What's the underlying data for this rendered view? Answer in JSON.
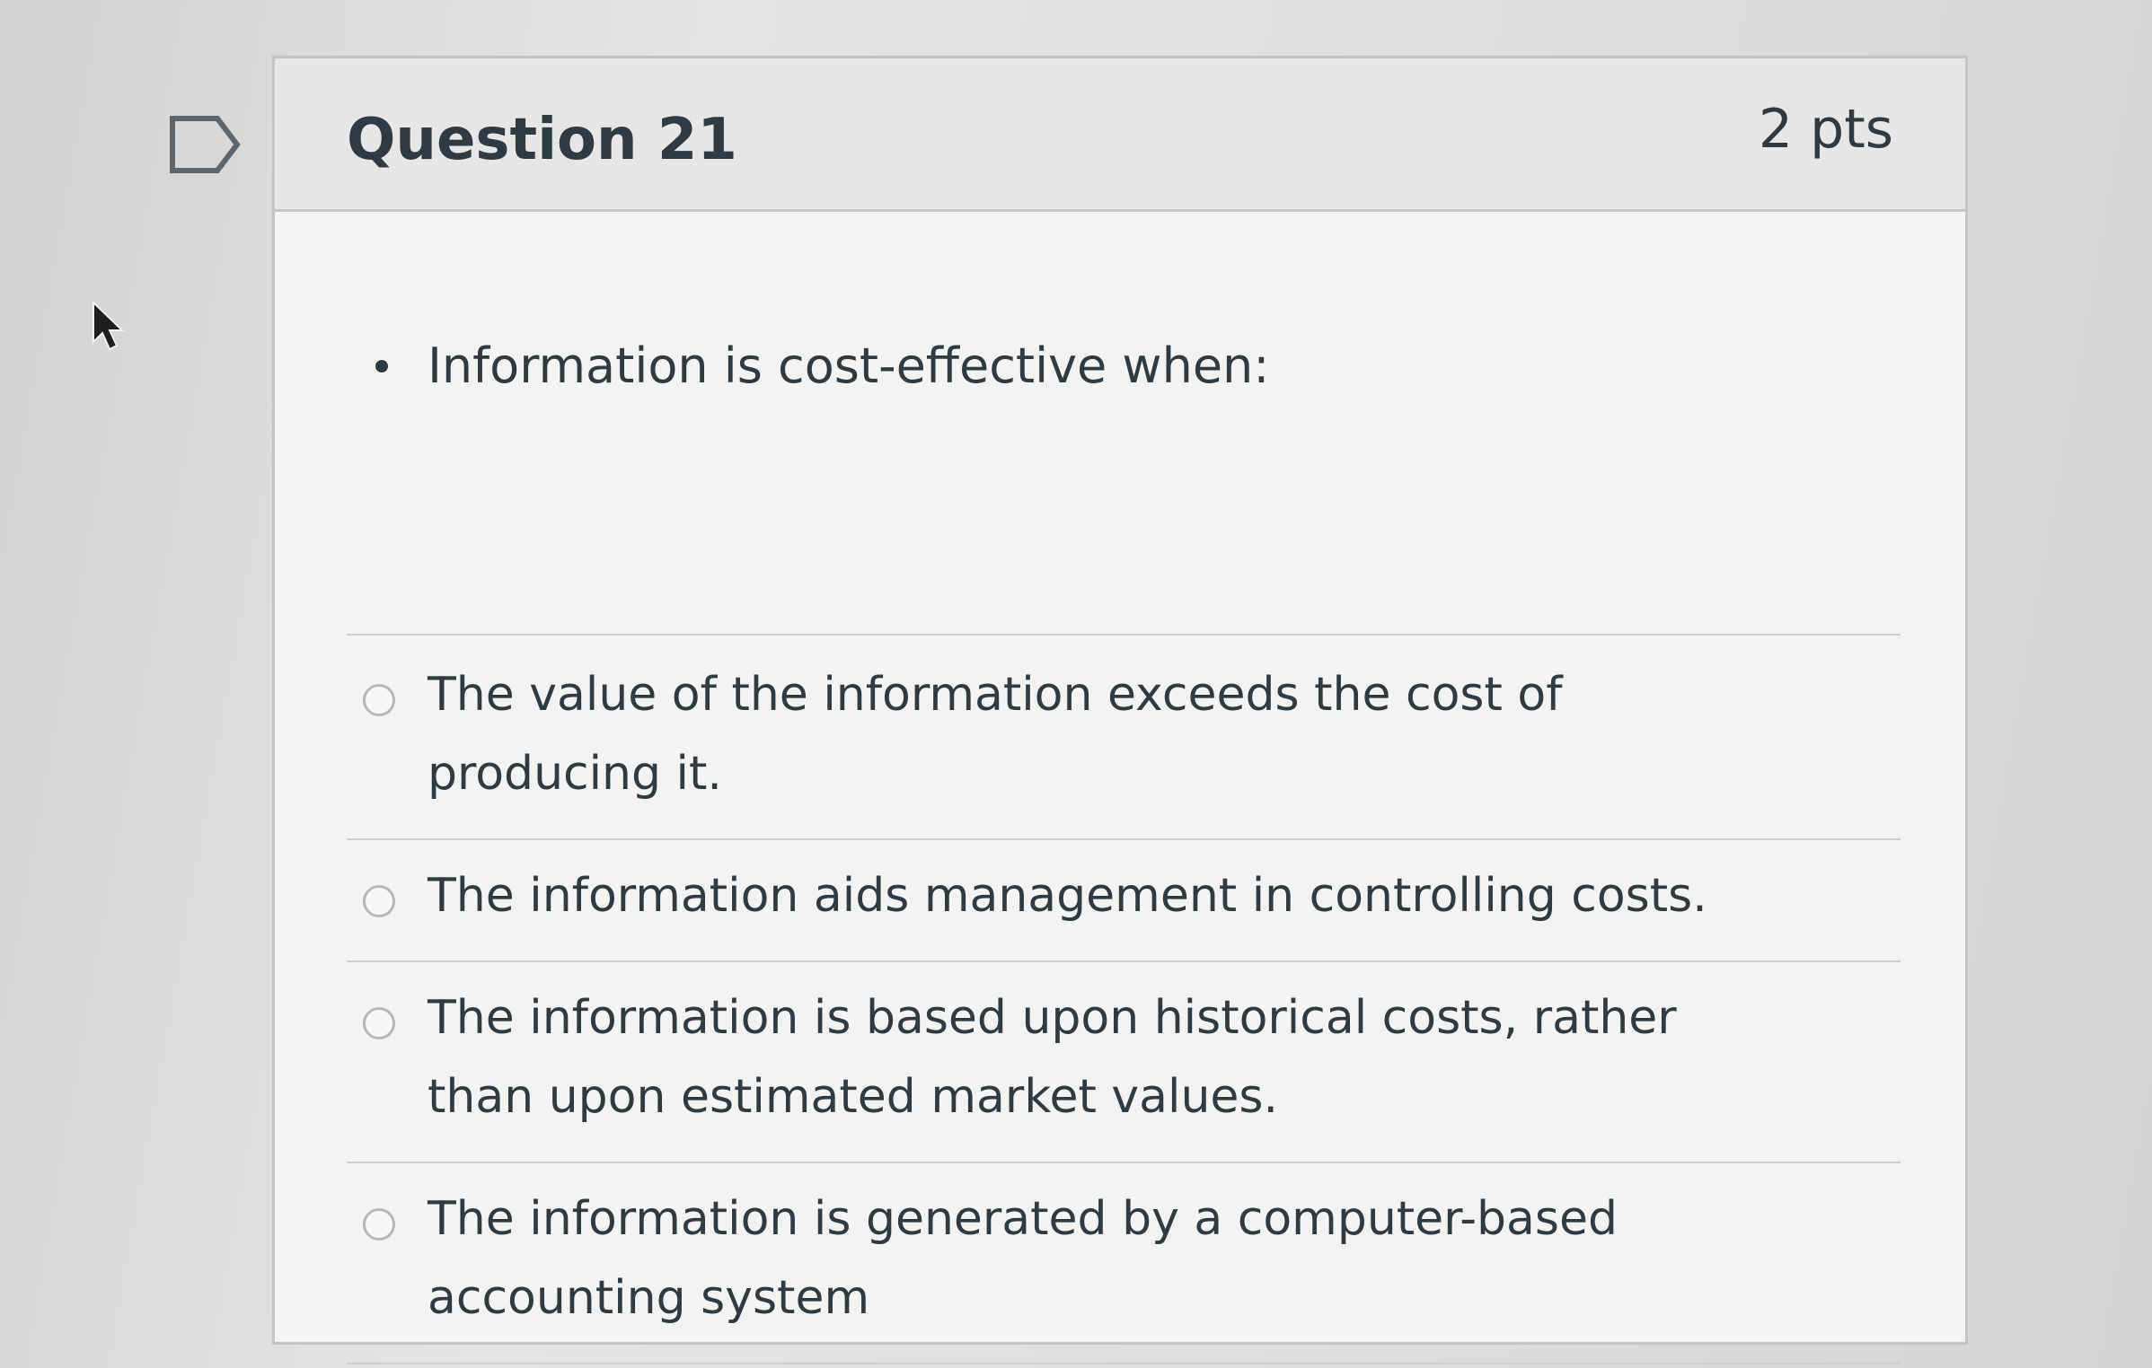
{
  "question": {
    "title": "Question 21",
    "points": "2 pts",
    "prompt": "Information is cost-effective when:",
    "answers": [
      {
        "text": "The value of the information exceeds the cost of producing it.",
        "selected": false
      },
      {
        "text": "The information aids management in controlling costs.",
        "selected": false
      },
      {
        "text": "The information is based upon historical costs, rather than upon estimated market values.",
        "selected": false
      },
      {
        "text": "The information is generated by a computer-based accounting system",
        "selected": false
      }
    ]
  },
  "icons": {
    "flag": "flag-outline-icon",
    "cursor": "mouse-pointer-icon"
  },
  "colors": {
    "text": "#2d3b45",
    "header_bg": "#e6e6e4",
    "card_bg": "#f3f3f1",
    "border": "#c4c4c2"
  }
}
